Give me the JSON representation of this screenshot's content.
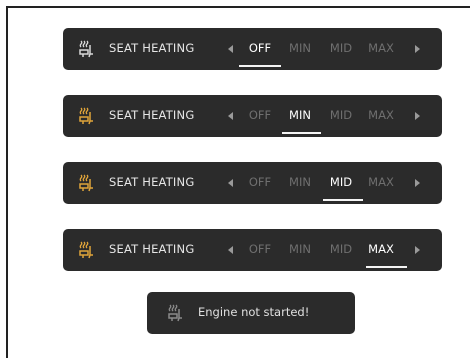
{
  "colors": {
    "bar_background": "#2b2b2b",
    "active_text": "#ffffff",
    "inactive_text": "#6f6f6f",
    "icon_active": "#e0a43a",
    "icon_inactive": "#d8d8d8"
  },
  "seat_heating_rows": [
    {
      "icon": "seat-heat-icon",
      "title": "SEAT HEATING",
      "options": [
        "OFF",
        "MIN",
        "MID",
        "MAX"
      ],
      "selected": "OFF"
    },
    {
      "icon": "seat-heat-icon",
      "title": "SEAT HEATING",
      "options": [
        "OFF",
        "MIN",
        "MID",
        "MAX"
      ],
      "selected": "MIN"
    },
    {
      "icon": "seat-heat-icon",
      "title": "SEAT HEATING",
      "options": [
        "OFF",
        "MIN",
        "MID",
        "MAX"
      ],
      "selected": "MID"
    },
    {
      "icon": "seat-heat-icon",
      "title": "SEAT HEATING",
      "options": [
        "OFF",
        "MIN",
        "MID",
        "MAX"
      ],
      "selected": "MAX"
    }
  ],
  "toast": {
    "icon": "seat-heat-icon",
    "message": "Engine not started!"
  }
}
